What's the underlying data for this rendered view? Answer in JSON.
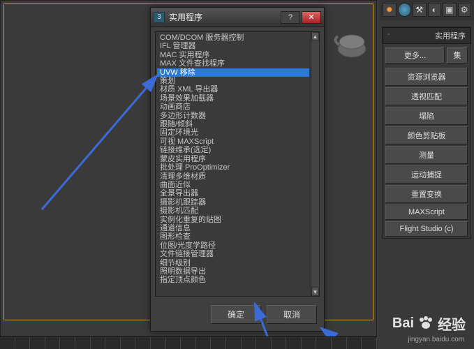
{
  "dialog": {
    "title": "实用程序",
    "ok": "确定",
    "cancel": "取消",
    "selected_index": 4,
    "items": [
      "COM/DCOM 服务器控制",
      "IFL 管理器",
      "MAC 实用程序",
      "MAX 文件查找程序",
      "UVW 移除",
      "策划",
      "材质 XML 导出器",
      "场景效果加载器",
      "动画商店",
      "多边形计数器",
      "跟随/倾斜",
      "固定环境光",
      "可视 MAXScript",
      "链接维承(选定)",
      "蒙皮实用程序",
      "批处理 ProOptimizer",
      "清理多维材质",
      "曲面近似",
      "全景导出器",
      "摄影机跟踪器",
      "摄影机匹配",
      "实例化重复的贴图",
      "通道信息",
      "图形检查",
      "位图/光度学路径",
      "文件链接管理器",
      "细节级别",
      "照明数据导出",
      "指定顶点颜色"
    ]
  },
  "side": {
    "title": "实用程序",
    "more": "更多...",
    "set": "集",
    "buttons": [
      "资源浏览器",
      "透视匹配",
      "塌陷",
      "颜色剪贴板",
      "测量",
      "运动捕捉",
      "重置变换",
      "MAXScript",
      "Flight Studio (c)"
    ]
  },
  "watermark": {
    "brand_a": "Bai",
    "brand_b": "经验",
    "url": "jingyan.baidu.com"
  }
}
